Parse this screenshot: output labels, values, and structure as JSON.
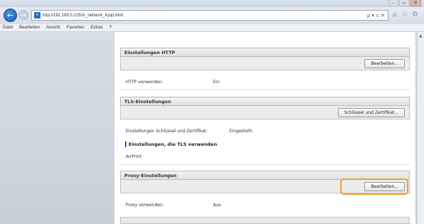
{
  "window": {
    "minimize_glyph": "–",
    "maximize_glyph": "▭",
    "close_glyph": "✕"
  },
  "browser": {
    "url": "http://192.168.0.215/m_network_tcpip.html",
    "search_glyph": "ρ ▾",
    "refresh_glyph": "ⅽ ✕",
    "home_glyph": "⌂",
    "favorites_glyph": "☆",
    "tools_glyph": "⚙"
  },
  "menu": {
    "items": [
      "Datei",
      "Bearbeiten",
      "Ansicht",
      "Favoriten",
      "Extras",
      "?"
    ]
  },
  "sections": {
    "http": {
      "title": "Einstellungen HTTP",
      "button": "Bearbeiten...",
      "rows": [
        {
          "label": "HTTP verwenden:",
          "value": "Ein"
        }
      ]
    },
    "tls": {
      "title": "TLS-Einstellungen",
      "button": "Schlüssel und Zertifikat...",
      "rows": [
        {
          "label": "Einstellungen Schlüssel und Zertifikat:",
          "value": "Eingestellt."
        }
      ],
      "subsection_title": "Einstellungen, die TLS verwenden",
      "subsection_items": [
        "AirPrint"
      ]
    },
    "proxy": {
      "title": "Proxy-Einstellungen",
      "button": "Bearbeiten...",
      "rows": [
        {
          "label": "Proxy verwenden:",
          "value": "Aus"
        }
      ]
    }
  },
  "colors": {
    "highlight": "#f0a21e",
    "accent": "#1e5bb8"
  }
}
